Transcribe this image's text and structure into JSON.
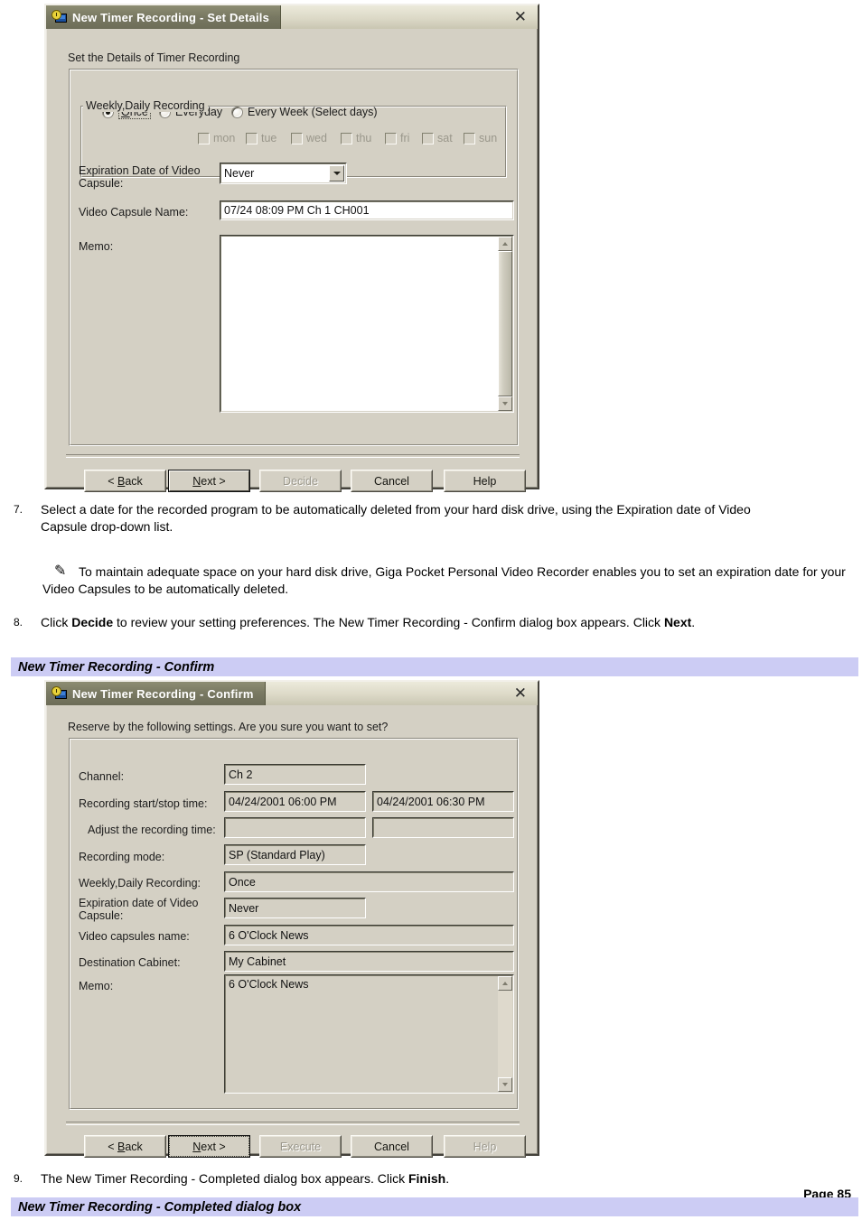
{
  "document": {
    "page_label": "Page 85"
  },
  "dialog1": {
    "title": "New Timer Recording - Set Details",
    "close_label": "✕",
    "heading": "Set the Details of Timer Recording",
    "groupbox_title": "Weekly,Daily Recording",
    "radios": [
      {
        "label": "Once",
        "checked": true,
        "focused": true,
        "accel": "O"
      },
      {
        "label": "Everyday",
        "checked": false,
        "focused": false,
        "accel": ""
      },
      {
        "label": "Every Week (Select days)",
        "checked": false,
        "focused": false,
        "accel": ""
      }
    ],
    "days": [
      "mon",
      "tue",
      "wed",
      "thu",
      "fri",
      "sat",
      "sun"
    ],
    "fields": {
      "expiration_label": "Expiration Date of Video\nCapsule:",
      "expiration_value": "Never",
      "capsule_name_label": "Video Capsule Name:",
      "capsule_name_value": "07/24 08:09 PM Ch 1 CH001",
      "memo_label": "Memo:",
      "memo_value": ""
    },
    "buttons": [
      {
        "label": "< Back",
        "accel": "B",
        "state": "normal"
      },
      {
        "label": "Next >",
        "accel": "N",
        "state": "default"
      },
      {
        "label": "Decide",
        "accel": "",
        "state": "disabled"
      },
      {
        "label": "Cancel",
        "accel": "",
        "state": "normal"
      },
      {
        "label": "Help",
        "accel": "",
        "state": "normal"
      }
    ]
  },
  "dialog2": {
    "title": "New Timer Recording - Confirm",
    "close_label": "✕",
    "heading": "Reserve by the following settings. Are you sure you want to set?",
    "rows": [
      {
        "label": "Channel:",
        "value": "Ch 2"
      },
      {
        "label": "Recording start/stop time:",
        "value": "04/24/2001 06:00 PM",
        "value2": "04/24/2001 06:30 PM"
      },
      {
        "label": "Adjust the recording time:",
        "value": "",
        "value2": ""
      },
      {
        "label": "Recording mode:",
        "value": "SP (Standard Play)"
      },
      {
        "label": "Weekly,Daily Recording:",
        "value": "Once"
      },
      {
        "label": "Expiration date of Video\nCapsule:",
        "value": "Never"
      },
      {
        "label": "Video capsules name:",
        "value": "6 O'Clock News"
      },
      {
        "label": "Destination Cabinet:",
        "value": "My Cabinet"
      },
      {
        "label": "Memo:",
        "value": "6 O'Clock News"
      }
    ],
    "buttons": [
      {
        "label": "< Back",
        "accel": "B",
        "state": "normal"
      },
      {
        "label": "Next >",
        "accel": "N",
        "state": "focus"
      },
      {
        "label": "Execute",
        "accel": "",
        "state": "disabled"
      },
      {
        "label": "Cancel",
        "accel": "",
        "state": "normal"
      },
      {
        "label": "Help",
        "accel": "",
        "state": "disabled"
      }
    ]
  },
  "steps": {
    "step7_num": "7.",
    "step7_text": "Select a date for the recorded program to be automatically deleted from your hard disk drive, using the Expiration date of Video Capsule drop-down list.",
    "note_icon": "✎",
    "note_text": "To maintain adequate space on your hard disk drive, Giga Pocket Personal Video Recorder enables you to set an expiration date for your Video Capsules to be automatically deleted.",
    "step8_num": "8.",
    "step8_text_a": "Click ",
    "step8_bold_a": "Decide",
    "step8_text_b": " to review your setting preferences. The New Timer Recording - Confirm dialog box appears. Click ",
    "step8_bold_b": "Next",
    "step8_text_c": ".",
    "step9_num": "9.",
    "step9_text_a": "The New Timer Recording - Completed dialog box appears. Click ",
    "step9_bold_a": "Finish",
    "step9_text_b": "."
  },
  "headings": {
    "confirm_bar": "New Timer Recording - Confirm",
    "completed_bar": "New Timer Recording - Completed dialog box"
  }
}
